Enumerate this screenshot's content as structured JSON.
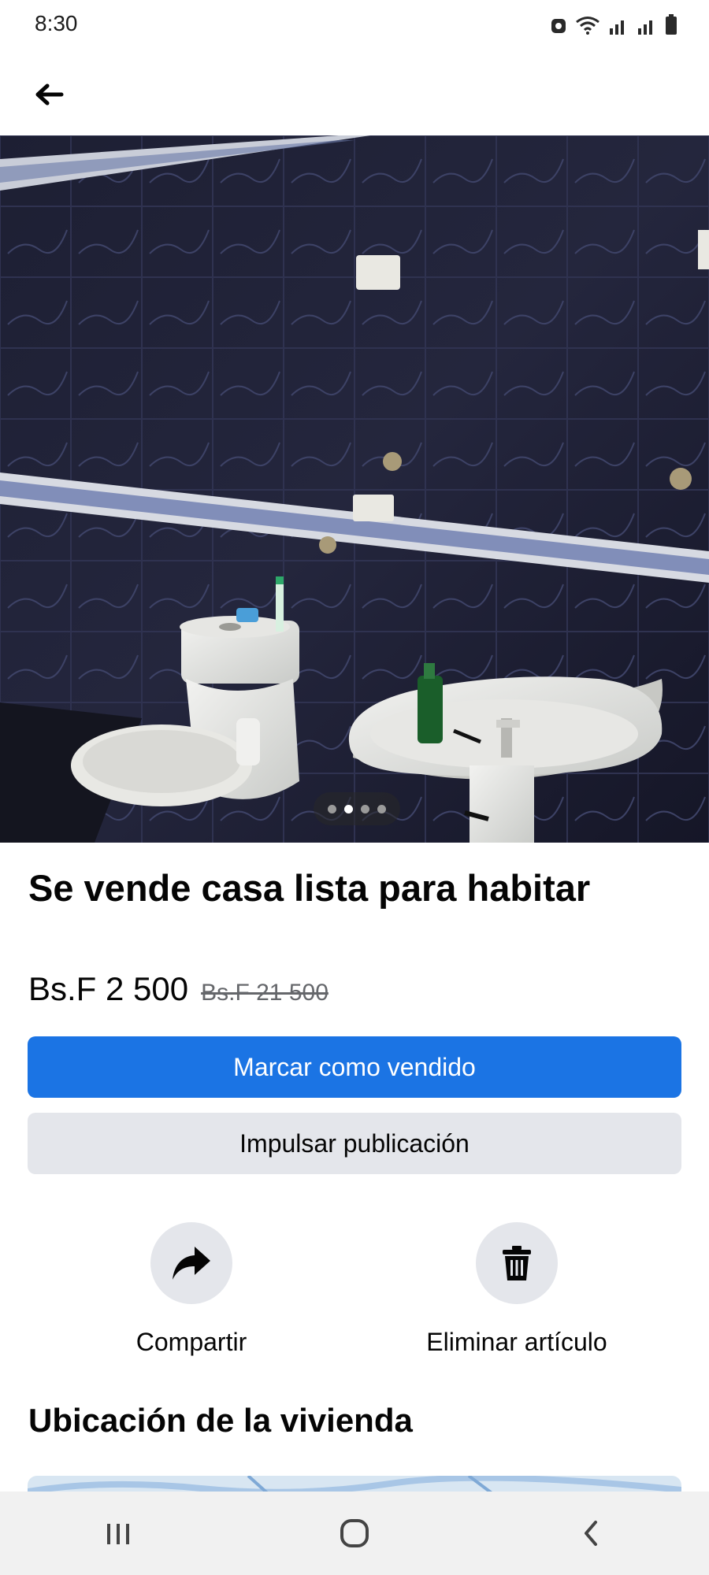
{
  "status": {
    "time": "8:30",
    "icons": [
      "alarm-icon",
      "wifi-icon",
      "signal-icon",
      "signal-icon",
      "battery-icon"
    ]
  },
  "header": {
    "back_icon": "arrow-left-icon"
  },
  "gallery": {
    "image_count": 4,
    "active_index": 1
  },
  "listing": {
    "title": "Se vende casa lista para habitar",
    "price": "Bs.F 2 500",
    "old_price": "Bs.F 21 500"
  },
  "buttons": {
    "mark_sold": "Marcar como vendido",
    "boost": "Impulsar publicación"
  },
  "actions": {
    "share_label": "Compartir",
    "share_icon": "share-arrow-icon",
    "delete_label": "Eliminar artículo",
    "delete_icon": "trash-icon"
  },
  "location": {
    "section_title": "Ubicación de la vivienda"
  },
  "navbar": {
    "icons": [
      "recent-apps-icon",
      "home-icon",
      "back-icon"
    ]
  },
  "colors": {
    "primary": "#1b74e4",
    "secondary_bg": "#e4e6eb",
    "text": "#050505",
    "muted": "#65676b"
  }
}
